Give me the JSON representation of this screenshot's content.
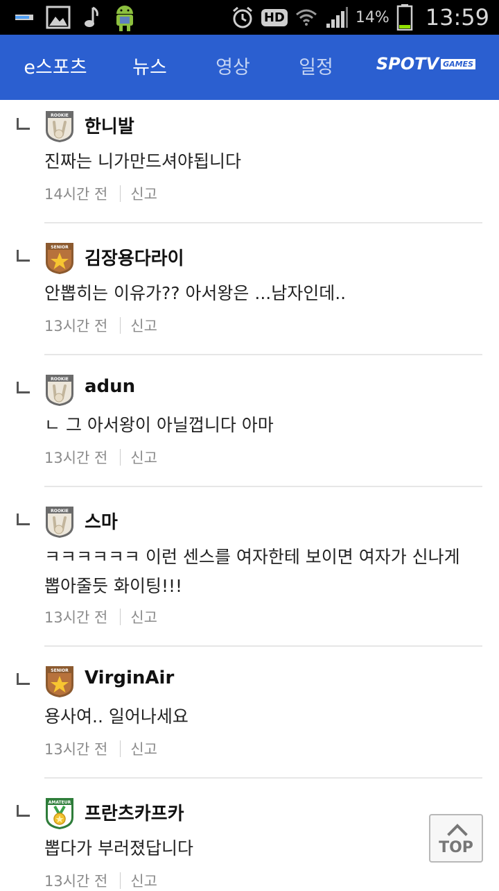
{
  "status_bar": {
    "battery_percent": "14%",
    "clock": "13:59",
    "hd_label": "HD",
    "icons": [
      "usb-icon",
      "gallery-icon",
      "music-note-icon",
      "android-icon",
      "alarm-icon",
      "hd-voice-icon",
      "wifi-icon",
      "signal-icon",
      "battery-icon"
    ]
  },
  "nav": {
    "tabs": [
      {
        "label": "e스포츠",
        "active": true
      },
      {
        "label": "뉴스",
        "active": true
      },
      {
        "label": "영상",
        "active": false
      },
      {
        "label": "일정",
        "active": false
      }
    ],
    "logo_main": "SPOTV",
    "logo_sub": "GAMES",
    "colors": {
      "bar": "#2b5fd0",
      "active": "#ffffff",
      "inactive": "#c5d4f3"
    }
  },
  "comments": [
    {
      "badge": "ROOKIE",
      "author": "한니발",
      "text": "진짜는 니가만드셔야됩니다",
      "time": "14시간 전",
      "report": "신고"
    },
    {
      "badge": "SENIOR",
      "author": "김장용다라이",
      "text": "안뽑히는 이유가?? 아서왕은 ...남자인데..",
      "time": "13시간 전",
      "report": "신고"
    },
    {
      "badge": "ROOKIE",
      "author": "adun",
      "text": "ㄴ 그 아서왕이 아닐껍니다 아마",
      "time": "13시간 전",
      "report": "신고"
    },
    {
      "badge": "ROOKIE",
      "author": "스마",
      "text": "ㅋㅋㅋㅋㅋㅋ 이런 센스를 여자한테 보이면 여자가 신나게 뽑아줄듯 화이팅!!!",
      "time": "13시간 전",
      "report": "신고"
    },
    {
      "badge": "SENIOR",
      "author": "VirginAir",
      "text": "용사여.. 일어나세요",
      "time": "13시간 전",
      "report": "신고"
    },
    {
      "badge": "AMATEUR",
      "author": "프란츠카프카",
      "text": "뽑다가 부러졌답니다",
      "time": "13시간 전",
      "report": "신고"
    }
  ],
  "top_button": {
    "label": "TOP"
  }
}
